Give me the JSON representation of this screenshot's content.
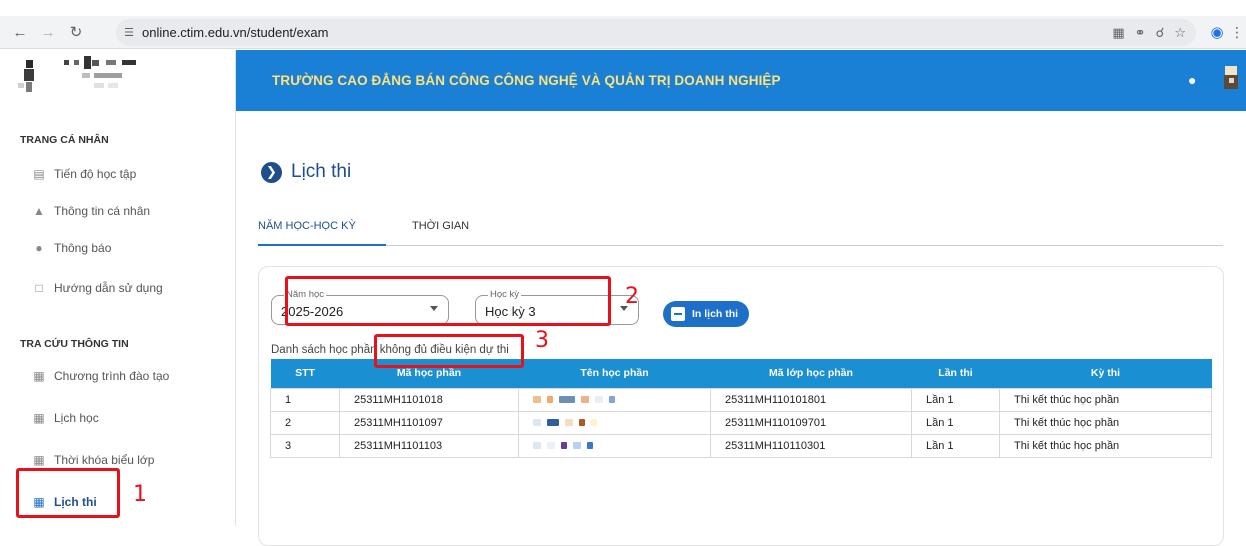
{
  "browser": {
    "url": "online.ctim.edu.vn/student/exam"
  },
  "header": {
    "title": "TRƯỜNG CAO ĐẲNG BÁN CÔNG CÔNG NGHỆ VÀ QUẢN TRỊ DOANH NGHIỆP"
  },
  "sidebar": {
    "section1": "TRANG CÁ NHÂN",
    "personal_items": [
      {
        "label": "Tiến độ học tập"
      },
      {
        "label": "Thông tin cá nhân"
      },
      {
        "label": "Thông báo"
      },
      {
        "label": "Hướng dẫn sử dụng"
      }
    ],
    "section2": "TRA CỨU THÔNG TIN",
    "lookup_items": [
      {
        "label": "Chương trình đào tạo"
      },
      {
        "label": "Lịch học"
      },
      {
        "label": "Thời khóa biểu lớp"
      },
      {
        "label": "Lịch thi"
      }
    ]
  },
  "main": {
    "page_title": "Lịch thi",
    "tabs": [
      {
        "label": "NĂM HỌC-HỌC KỲ"
      },
      {
        "label": "THỜI GIAN"
      }
    ],
    "year_select": {
      "legend": "Năm học",
      "value": "2025-2026"
    },
    "semester_select": {
      "legend": "Học kỳ",
      "value": "Học kỳ 3"
    },
    "print_button": "In lịch thi",
    "list_label": "Danh sách học phần không đủ điều kiện dự thi",
    "table": {
      "headers": [
        "STT",
        "Mã học phần",
        "Tên học phần",
        "Mã lớp học phần",
        "Lần thi",
        "Kỳ thi"
      ],
      "rows": [
        {
          "stt": "1",
          "ma_hp": "25311MH1101018",
          "ma_lop": "25311MH110101801",
          "lan_thi": "Lần 1",
          "ky_thi": "Thi kết thúc học phần"
        },
        {
          "stt": "2",
          "ma_hp": "25311MH1101097",
          "ma_lop": "25311MH110109701",
          "lan_thi": "Lần 1",
          "ky_thi": "Thi kết thúc học phần"
        },
        {
          "stt": "3",
          "ma_hp": "25311MH1101103",
          "ma_lop": "25311MH110110301",
          "lan_thi": "Lần 1",
          "ky_thi": "Thi kết thúc học phần"
        }
      ]
    }
  },
  "annotations": [
    "1",
    "2",
    "3"
  ],
  "colors": {
    "header_bg": "#1a80d5",
    "header_title": "#ffe27a",
    "accent": "#1e4e8c",
    "table_header": "#1a8fd1",
    "annotation": "#e8111a"
  }
}
